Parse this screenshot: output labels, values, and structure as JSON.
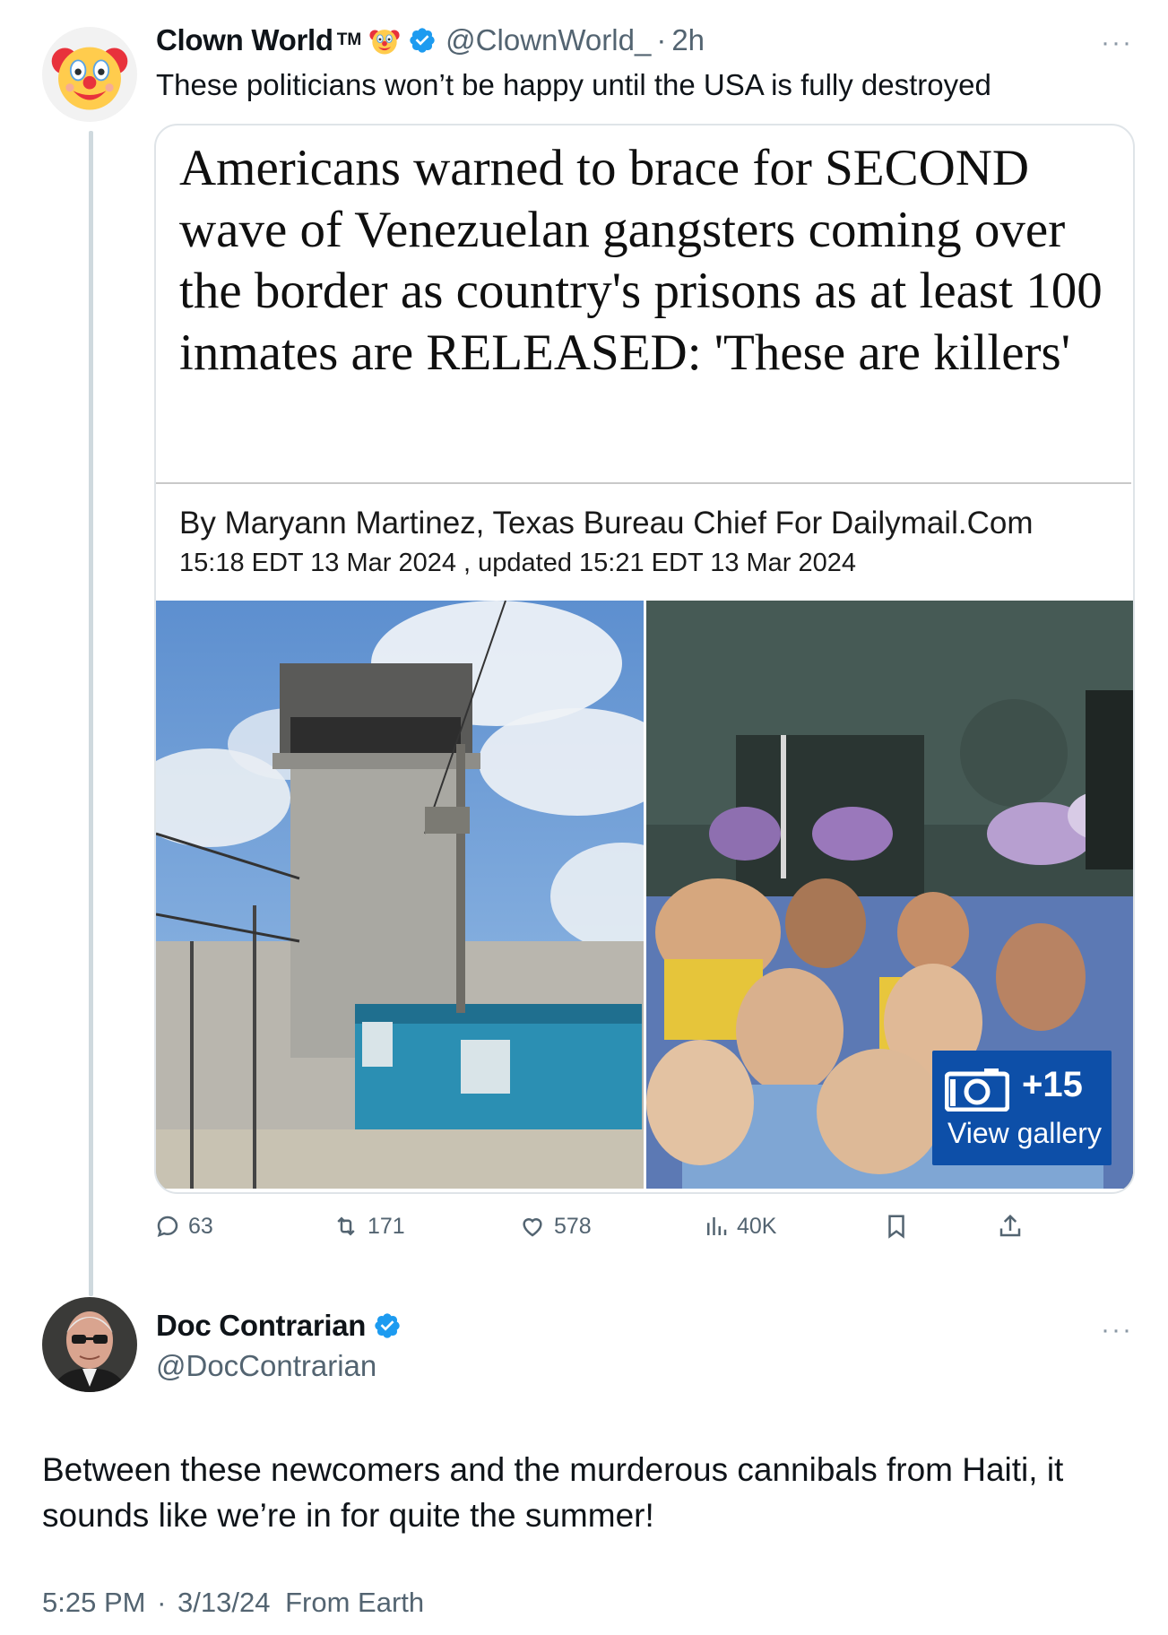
{
  "parent_tweet": {
    "display_name": "Clown World",
    "trademark": "TM",
    "name_emoji": "clown-face",
    "verified": true,
    "handle": "@ClownWorld_",
    "separator": "·",
    "time_ago": "2h",
    "text": "These politicians won’t be happy until the USA is fully destroyed",
    "more_label": "···",
    "quoted_article": {
      "headline": "Americans warned to brace for SECOND wave of Venezuelan gangsters coming over the border as country's prisons as at least 100 inmates are RELEASED: 'These are killers'",
      "byline": "By Maryann Martinez, Texas Bureau Chief For Dailymail.Com",
      "dateline": "15:18 EDT 13 Mar 2024 , updated 15:21 EDT 13 Mar 2024",
      "gallery_count": "+15",
      "gallery_label": "View gallery"
    },
    "actions": {
      "replies": "63",
      "reposts": "171",
      "likes": "578",
      "views": "40K"
    }
  },
  "reply_tweet": {
    "display_name": "Doc Contrarian",
    "verified": true,
    "handle": "@DocContrarian",
    "more_label": "···",
    "text": "Between these newcomers and the murderous cannibals from Haiti, it sounds like we’re in for quite the summer!",
    "time": "5:25 PM",
    "separator": "·",
    "date": "3/13/24",
    "source": "From Earth"
  },
  "colors": {
    "verified_blue": "#1d9bf0",
    "secondary_text": "#536471",
    "gallery_blue": "#0d4fa8",
    "thread_line": "#cfd9de"
  }
}
